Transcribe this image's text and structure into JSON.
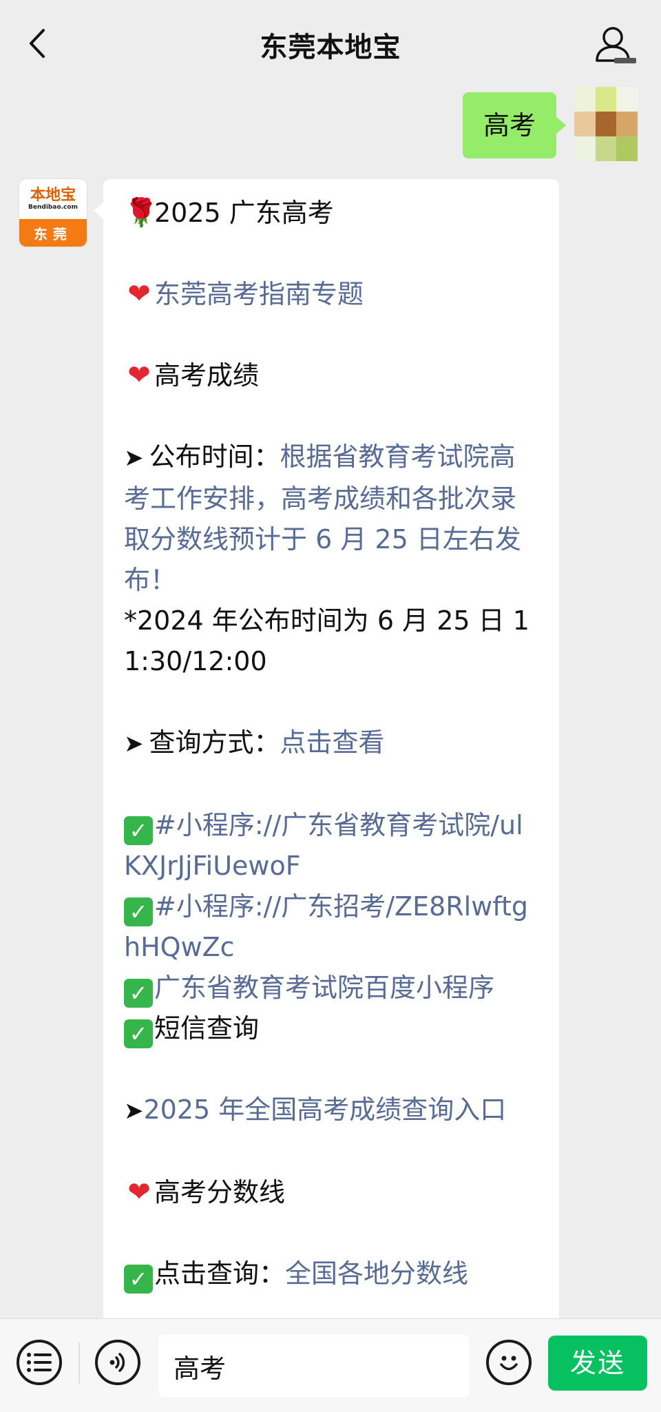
{
  "header": {
    "title": "东莞本地宝",
    "back_icon": "chevron-left-icon",
    "profile_icon": "user-icon"
  },
  "messages": {
    "user_text": "高考",
    "bot_avatar": {
      "logo_text": "本地宝",
      "logo_domain": "Bendibao.com",
      "logo_city": "东莞"
    },
    "bot": {
      "title": "2025 广东高考",
      "guide_link": "东莞高考指南专题",
      "score_heading": "高考成绩",
      "publish_label": "公布时间：",
      "publish_text": "根据省教育考试院高考工作安排，高考成绩和各批次录取分数线预计于 6 月 25 日左右发布！",
      "publish_note": "*2024 年公布时间为 6 月 25 日 11:30/12:00",
      "query_label": "查询方式：",
      "query_link": "点击查看",
      "mini_program_1": "#小程序://广东省教育考试院/ulKXJrJjFiUewoF",
      "mini_program_2": "#小程序://广东招考/ZE8RlwftghHQwZc",
      "baidu_program": "广东省教育考试院百度小程序",
      "sms_query": "短信查询",
      "national_link": "2025 年全国高考成绩查询入口",
      "cutoff_heading": "高考分数线",
      "cutoff_label": "点击查询：",
      "cutoff_link": "全国各地分数线"
    }
  },
  "input_bar": {
    "menu_icon": "list-icon",
    "voice_icon": "voice-icon",
    "input_value": "高考",
    "emoji_icon": "emoji-icon",
    "send_label": "发送"
  },
  "colors": {
    "link": "#576b95",
    "user_bubble": "#95ec69",
    "send_button": "#07c160",
    "background": "#ededed"
  }
}
